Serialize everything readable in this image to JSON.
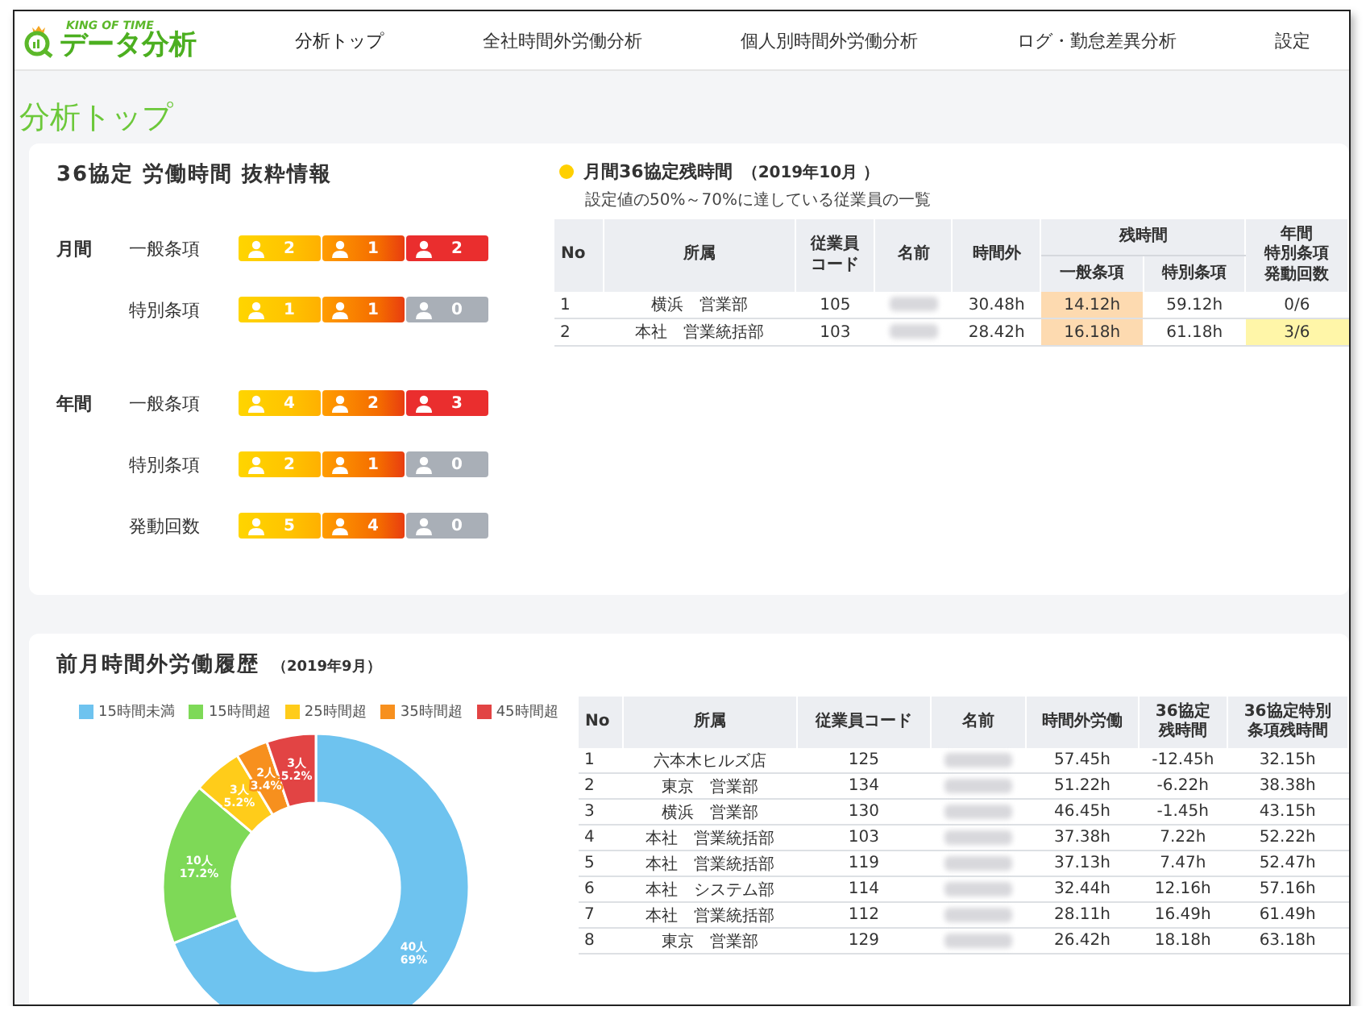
{
  "header": {
    "logo_small": "KING OF TIME",
    "logo": "データ分析",
    "nav": [
      {
        "label": "分析トップ",
        "selected": true
      },
      {
        "label": "全社時間外労働分析",
        "selected": false
      },
      {
        "label": "個人別時間外労働分析",
        "selected": false
      },
      {
        "label": "ログ・勤怠差異分析",
        "selected": false
      },
      {
        "label": "設定",
        "selected": false
      }
    ]
  },
  "page_title": "分析トップ",
  "summary": {
    "title": "36協定 労働時間 抜粋情報",
    "groups": [
      {
        "period": "月間",
        "rows": [
          {
            "label": "一般条項",
            "badges": [
              {
                "count": "2",
                "kind": "caution",
                "active": true
              },
              {
                "count": "1",
                "kind": "warning",
                "active": true
              },
              {
                "count": "2",
                "kind": "over",
                "active": true
              }
            ]
          },
          {
            "label": "特別条項",
            "badges": [
              {
                "count": "1",
                "kind": "caution",
                "active": true
              },
              {
                "count": "1",
                "kind": "warning",
                "active": true
              },
              {
                "count": "0",
                "kind": "over",
                "active": false
              }
            ]
          }
        ]
      },
      {
        "period": "年間",
        "rows": [
          {
            "label": "一般条項",
            "badges": [
              {
                "count": "4",
                "kind": "caution",
                "active": true
              },
              {
                "count": "2",
                "kind": "warning",
                "active": true
              },
              {
                "count": "3",
                "kind": "over",
                "active": true
              }
            ]
          },
          {
            "label": "特別条項",
            "badges": [
              {
                "count": "2",
                "kind": "caution",
                "active": true
              },
              {
                "count": "1",
                "kind": "warning",
                "active": true
              },
              {
                "count": "0",
                "kind": "over",
                "active": false
              }
            ]
          },
          {
            "label": "発動回数",
            "badges": [
              {
                "count": "5",
                "kind": "caution",
                "active": true
              },
              {
                "count": "4",
                "kind": "warning",
                "active": true
              },
              {
                "count": "0",
                "kind": "over",
                "active": false
              }
            ]
          }
        ]
      }
    ]
  },
  "alert": {
    "title": "月間36協定残時間",
    "period": "（2019年10月 ）",
    "subtitle": "設定値の50%～70%に達している従業員の一覧",
    "columns": {
      "no": "No",
      "dept": "所属",
      "code": [
        "従業員",
        "コード"
      ],
      "name": "名前",
      "overtime": "時間外",
      "remain": "残時間",
      "general": "一般条項",
      "special": "特別条項",
      "count": [
        "年間",
        "特別条項",
        "発動回数"
      ]
    },
    "rows": [
      {
        "no": "1",
        "dept": "横浜　営業部",
        "code": "105",
        "overtime": "30.48h",
        "general": "14.12h",
        "special": "59.12h",
        "count": "0/6",
        "general_highlight": true,
        "count_highlight": false
      },
      {
        "no": "2",
        "dept": "本社　営業統括部",
        "code": "103",
        "overtime": "28.42h",
        "general": "16.18h",
        "special": "61.18h",
        "count": "3/6",
        "general_highlight": true,
        "count_highlight": true
      }
    ]
  },
  "history": {
    "title": "前月時間外労働履歴",
    "period": "（2019年9月）",
    "chart_data": {
      "type": "donut",
      "categories": [
        "15時間未満",
        "15時間超",
        "25時間超",
        "35時間超",
        "45時間超"
      ],
      "colors": [
        "#6ec3ef",
        "#7ed957",
        "#ffcc1a",
        "#f7901e",
        "#e24444"
      ],
      "values": [
        69,
        17.2,
        5.2,
        3.4,
        5.2
      ],
      "value_labels": [
        [
          "40人",
          "69%"
        ],
        [
          "10人",
          "17.2%"
        ],
        [
          "3人",
          "5.2%"
        ],
        [
          "2人",
          "3.4%"
        ],
        [
          "3人",
          "5.2%"
        ]
      ]
    },
    "columns": [
      "No",
      "所属",
      "従業員コード",
      "名前",
      "時間外労働",
      [
        "36協定",
        "残時間"
      ],
      [
        "36協定特別",
        "条項残時間"
      ]
    ],
    "rows": [
      {
        "no": "1",
        "dept": "六本木ヒルズ店",
        "code": "125",
        "overtime": "57.45h",
        "remain": "-12.45h",
        "special_remain": "32.15h"
      },
      {
        "no": "2",
        "dept": "東京　営業部",
        "code": "134",
        "overtime": "51.22h",
        "remain": "-6.22h",
        "special_remain": "38.38h"
      },
      {
        "no": "3",
        "dept": "横浜　営業部",
        "code": "130",
        "overtime": "46.45h",
        "remain": "-1.45h",
        "special_remain": "43.15h"
      },
      {
        "no": "4",
        "dept": "本社　営業統括部",
        "code": "103",
        "overtime": "37.38h",
        "remain": "7.22h",
        "special_remain": "52.22h"
      },
      {
        "no": "5",
        "dept": "本社　営業統括部",
        "code": "119",
        "overtime": "37.13h",
        "remain": "7.47h",
        "special_remain": "52.47h"
      },
      {
        "no": "6",
        "dept": "本社　システム部",
        "code": "114",
        "overtime": "32.44h",
        "remain": "12.16h",
        "special_remain": "57.16h"
      },
      {
        "no": "7",
        "dept": "本社　営業統括部",
        "code": "112",
        "overtime": "28.11h",
        "remain": "16.49h",
        "special_remain": "61.49h"
      },
      {
        "no": "8",
        "dept": "東京　営業部",
        "code": "129",
        "overtime": "26.42h",
        "remain": "18.18h",
        "special_remain": "63.18h"
      }
    ]
  }
}
